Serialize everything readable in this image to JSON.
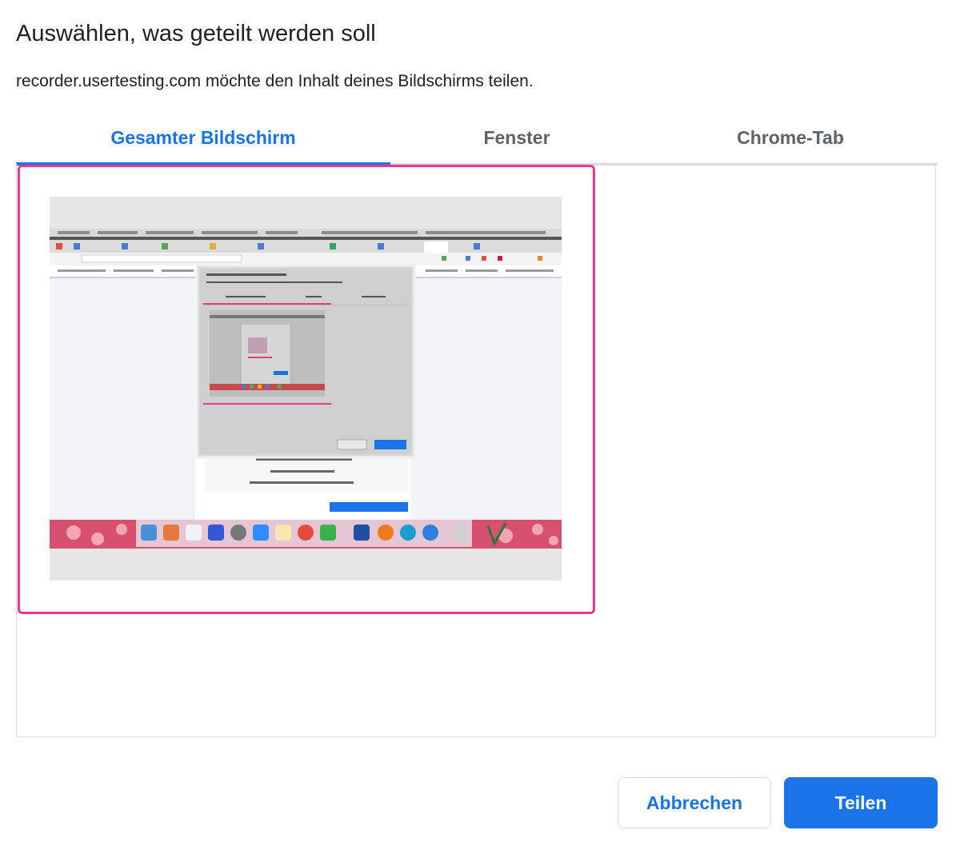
{
  "dialog": {
    "title": "Auswählen, was geteilt werden soll",
    "subtitle": "recorder.usertesting.com möchte den Inhalt deines Bildschirms teilen."
  },
  "tabs": [
    {
      "label": "Gesamter Bildschirm",
      "active": true
    },
    {
      "label": "Fenster",
      "active": false
    },
    {
      "label": "Chrome-Tab",
      "active": false
    }
  ],
  "sources": [
    {
      "kind": "entire-screen",
      "selected": true,
      "thumbnail": "screen-preview"
    }
  ],
  "buttons": {
    "cancel_label": "Abbrechen",
    "share_label": "Teilen"
  },
  "colors": {
    "accent": "#1a73e8",
    "selection": "#e8398d",
    "tab_inactive": "#5f6368",
    "divider": "#dadce0"
  }
}
